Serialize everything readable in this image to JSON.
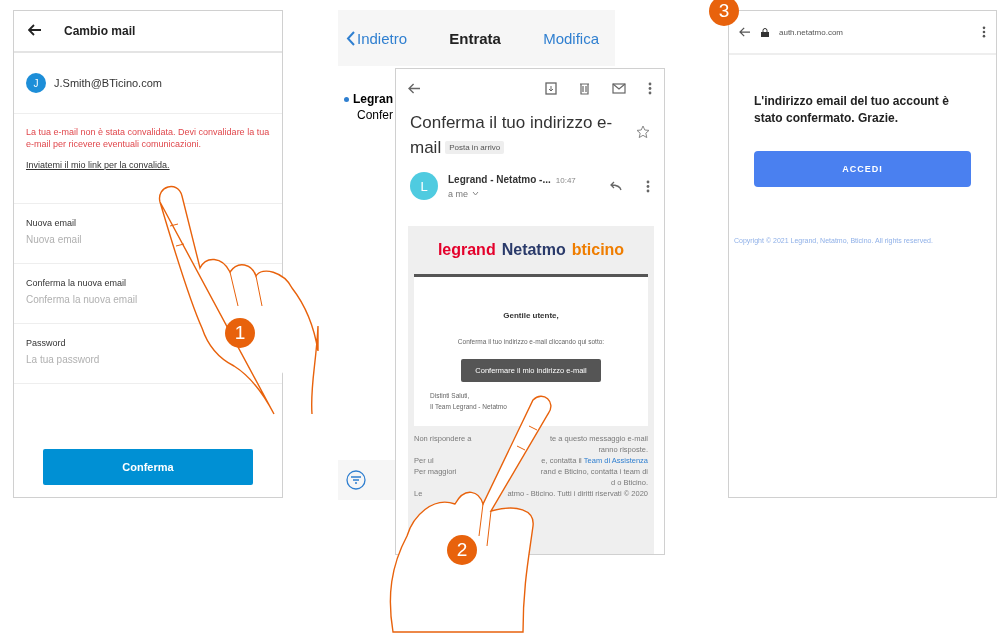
{
  "app_screen": {
    "step": "1",
    "title": "Cambio mail",
    "account": {
      "initial": "J",
      "email": "J.Smith@BTicino.com"
    },
    "warning": "La tua e-mail non è stata convalidata. Devi convalidare la tua e-mail per ricevere eventuali comunicazioni.",
    "link": "Inviatemi il mio link per la convalida.",
    "fields": [
      {
        "label": "Nuova email",
        "placeholder": "Nuova email"
      },
      {
        "label": "Conferma la nuova email",
        "placeholder": "Conferma la nuova email"
      },
      {
        "label": "Password",
        "placeholder": "La tua password"
      }
    ],
    "button": "Conferma"
  },
  "mail_list": {
    "back": "Indietro",
    "title": "Entrata",
    "action": "Modifica",
    "item": {
      "sender": "Legran",
      "preview": "Confer"
    }
  },
  "mail_screen": {
    "step": "2",
    "subject": "Conferma il tuo indirizzo e-mail",
    "tag": "Posta in arrivo",
    "sender_initial": "L",
    "sender": "Legrand - Netatmo -...",
    "time": "10:47",
    "recipient": "a me",
    "logos": [
      "legrand",
      "Netatmo",
      "bticino"
    ],
    "greeting": "Gentile utente,",
    "body": "Conferma il tuo indirizzo e-mail cliccando qui sotto:",
    "button": "Confermare il mio indirizzo e-mail",
    "closing": "Distinti Saluti,",
    "signature": "Il Team Legrand - Netatmo",
    "footer": [
      {
        "left": "Non rispondere a",
        "right": "te a questo messaggio e-mail"
      },
      {
        "right": "ranno risposte."
      },
      {
        "left": "Per ul",
        "right": "e, contatta il",
        "link": "Team di Assistenza"
      },
      {
        "left": "Per maggiori",
        "right": "rand e Bticino, contatta i team di"
      },
      {
        "right": "d o Bticino."
      },
      {
        "left": "Le",
        "right": "atmo - Bticino. Tutti i diritti riservati © 2020"
      }
    ]
  },
  "browser_screen": {
    "step": "3",
    "url": "auth.netatmo.com",
    "message": "L'indirizzo email del tuo account è stato confermato. Grazie.",
    "button": "ACCEDI",
    "copyright": "Copyright © 2021 Legrand, Netatmo, Bticino. All rights reserved."
  }
}
